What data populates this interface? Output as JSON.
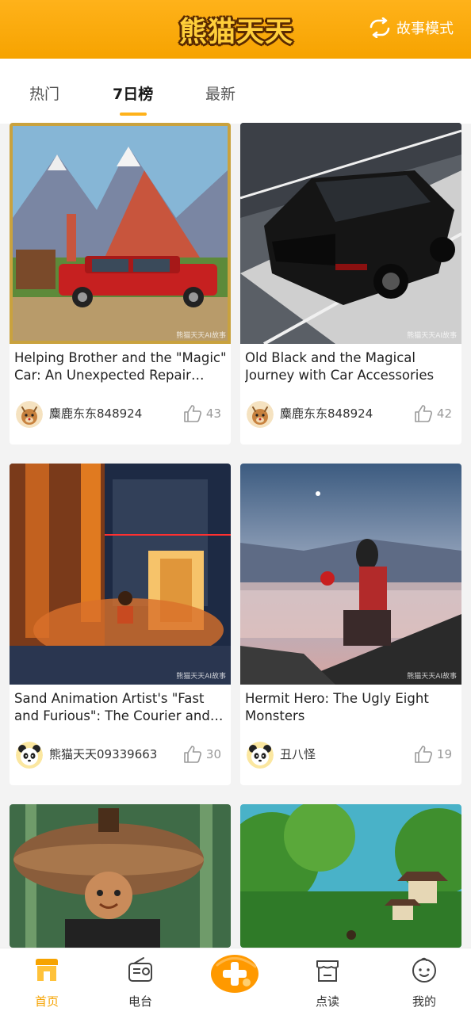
{
  "header": {
    "logo_text": "熊猫天天",
    "story_mode_label": "故事模式",
    "accent": "#f6a300"
  },
  "tabs": [
    {
      "label": "热门",
      "active": false
    },
    {
      "label": "7日榜",
      "active": true
    },
    {
      "label": "最新",
      "active": false
    }
  ],
  "cards": [
    {
      "title": "Helping Brother and the \"Magic\" Car: An Unexpected Repair Adventure",
      "author": "麋鹿东东848924",
      "likes": "43",
      "watermark": "熊猫天天AI故事",
      "avatar": "deer-avatar"
    },
    {
      "title": "Old Black and the Magical Journey with Car Accessories",
      "author": "麋鹿东东848924",
      "likes": "42",
      "watermark": "熊猫天天AI故事",
      "avatar": "deer-avatar"
    },
    {
      "title": "Sand Animation Artist's \"Fast and Furious\": The Courier and the Shadow",
      "author": "熊猫天天09339663",
      "likes": "30",
      "watermark": "熊猫天天AI故事",
      "avatar": "panda-avatar"
    },
    {
      "title": "Hermit Hero: The Ugly Eight Monsters",
      "author": "丑八怪",
      "likes": "19",
      "watermark": "熊猫天天AI故事",
      "avatar": "panda-avatar"
    },
    {
      "title": "",
      "author": "",
      "likes": "",
      "watermark": "",
      "avatar": ""
    },
    {
      "title": "",
      "author": "",
      "likes": "",
      "watermark": "",
      "avatar": ""
    }
  ],
  "bottom_nav": [
    {
      "label": "首页",
      "icon": "home-store-icon",
      "active": true
    },
    {
      "label": "电台",
      "icon": "radio-icon",
      "active": false
    },
    {
      "label": "",
      "icon": "add-icon",
      "active": false
    },
    {
      "label": "点读",
      "icon": "shop-icon",
      "active": false
    },
    {
      "label": "我的",
      "icon": "baby-face-icon",
      "active": false
    }
  ]
}
